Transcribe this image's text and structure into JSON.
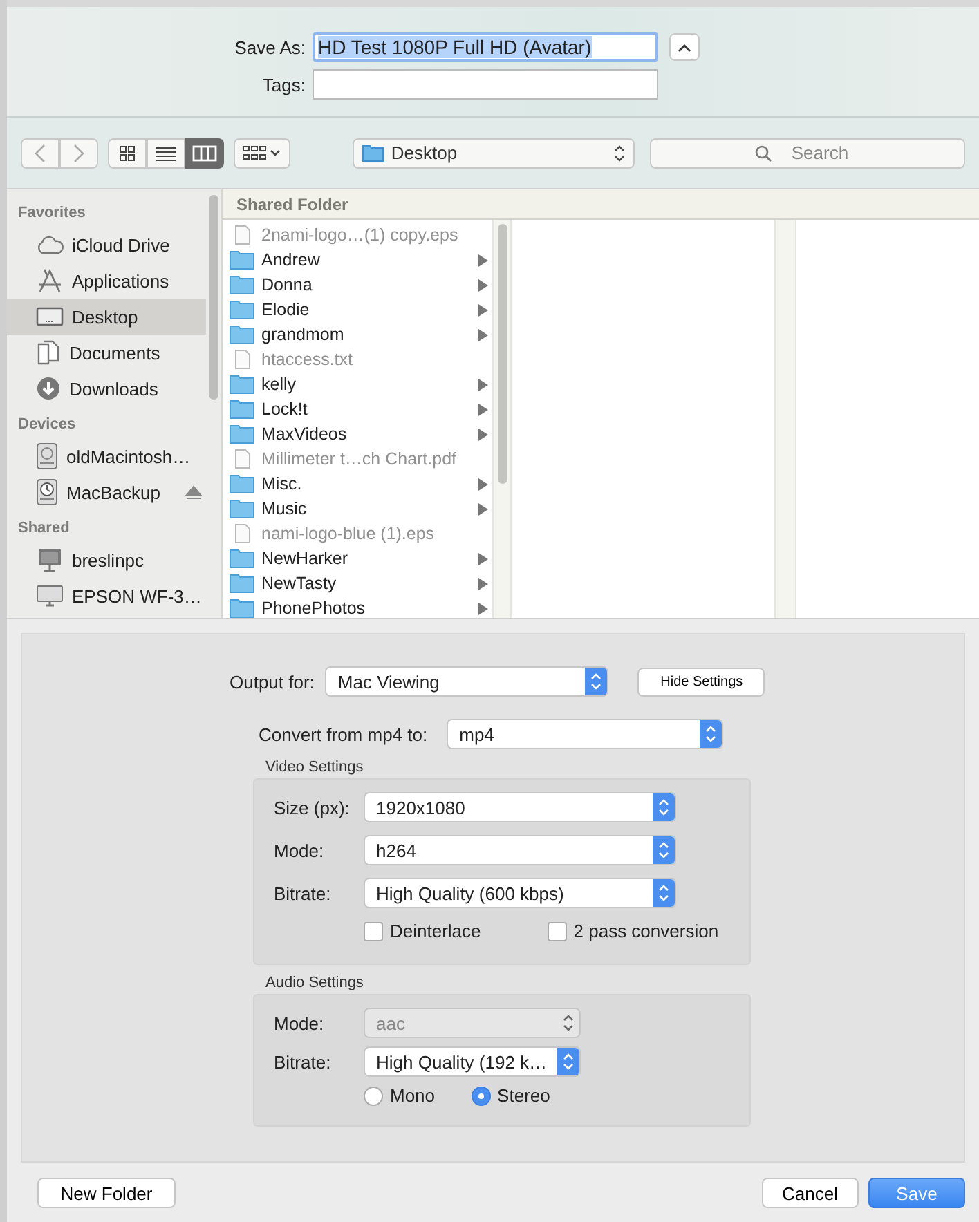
{
  "save_as": {
    "label": "Save As:",
    "value": "HD Test 1080P Full HD (Avatar)"
  },
  "tags": {
    "label": "Tags:"
  },
  "toolbar": {
    "views": [
      {
        "kind": "icons",
        "selected": false
      },
      {
        "kind": "list",
        "selected": false
      },
      {
        "kind": "columns",
        "selected": true
      }
    ],
    "location": "Desktop",
    "search": {
      "placeholder": "Search"
    }
  },
  "sidebar": [
    {
      "heading": "Favorites",
      "items": [
        {
          "label": "iCloud Drive",
          "kind": "cloud",
          "selected": false,
          "ejectable": false
        },
        {
          "label": "Applications",
          "kind": "apps",
          "selected": false,
          "ejectable": false
        },
        {
          "label": "Desktop",
          "kind": "desktop",
          "selected": true,
          "ejectable": false
        },
        {
          "label": "Documents",
          "kind": "documents",
          "selected": false,
          "ejectable": false
        },
        {
          "label": "Downloads",
          "kind": "downloads",
          "selected": false,
          "ejectable": false
        }
      ]
    },
    {
      "heading": "Devices",
      "items": [
        {
          "label": "oldMacintosh…",
          "kind": "disk",
          "selected": false,
          "ejectable": false
        },
        {
          "label": "MacBackup",
          "kind": "backup",
          "selected": false,
          "ejectable": true
        }
      ]
    },
    {
      "heading": "Shared",
      "items": [
        {
          "label": "breslinpc",
          "kind": "pc",
          "selected": false,
          "ejectable": false
        },
        {
          "label": "EPSON WF-3…",
          "kind": "display",
          "selected": false,
          "ejectable": false
        }
      ]
    }
  ],
  "browser": {
    "column_header": "Shared Folder",
    "items": [
      {
        "name": "2nami-logo…(1) copy.eps",
        "kind": "file"
      },
      {
        "name": "Andrew",
        "kind": "folder"
      },
      {
        "name": "Donna",
        "kind": "folder"
      },
      {
        "name": "Elodie",
        "kind": "folder"
      },
      {
        "name": "grandmom",
        "kind": "folder"
      },
      {
        "name": "htaccess.txt",
        "kind": "file"
      },
      {
        "name": "kelly",
        "kind": "folder"
      },
      {
        "name": "Lock!t",
        "kind": "folder"
      },
      {
        "name": "MaxVideos",
        "kind": "folder"
      },
      {
        "name": "Millimeter t…ch Chart.pdf",
        "kind": "file"
      },
      {
        "name": "Misc.",
        "kind": "folder"
      },
      {
        "name": "Music",
        "kind": "folder"
      },
      {
        "name": "nami-logo-blue (1).eps",
        "kind": "file"
      },
      {
        "name": "NewHarker",
        "kind": "folder"
      },
      {
        "name": "NewTasty",
        "kind": "folder"
      },
      {
        "name": "PhonePhotos",
        "kind": "folder"
      }
    ]
  },
  "settings": {
    "output_for": {
      "label": "Output for:",
      "value": "Mac Viewing"
    },
    "hide_button": "Hide Settings",
    "convert": {
      "label": "Convert from mp4 to:",
      "value": "mp4"
    },
    "video": {
      "title": "Video Settings",
      "fields": [
        {
          "label": "Size (px):",
          "value": "1920x1080",
          "disabled": false
        },
        {
          "label": "Mode:",
          "value": "h264",
          "disabled": false
        },
        {
          "label": "Bitrate:",
          "value": "High Quality (600 kbps)",
          "disabled": false
        }
      ],
      "checkboxes": [
        {
          "label": "Deinterlace",
          "checked": false
        },
        {
          "label": "2 pass conversion",
          "checked": false
        }
      ]
    },
    "audio": {
      "title": "Audio Settings",
      "fields": [
        {
          "label": "Mode:",
          "value": "aac",
          "disabled": true
        },
        {
          "label": "Bitrate:",
          "value": "High Quality (192 k…",
          "disabled": false
        }
      ],
      "channels": [
        {
          "label": "Mono",
          "selected": false
        },
        {
          "label": "Stereo",
          "selected": true
        }
      ]
    }
  },
  "buttons": {
    "new_folder": "New Folder",
    "cancel": "Cancel",
    "save": "Save"
  }
}
